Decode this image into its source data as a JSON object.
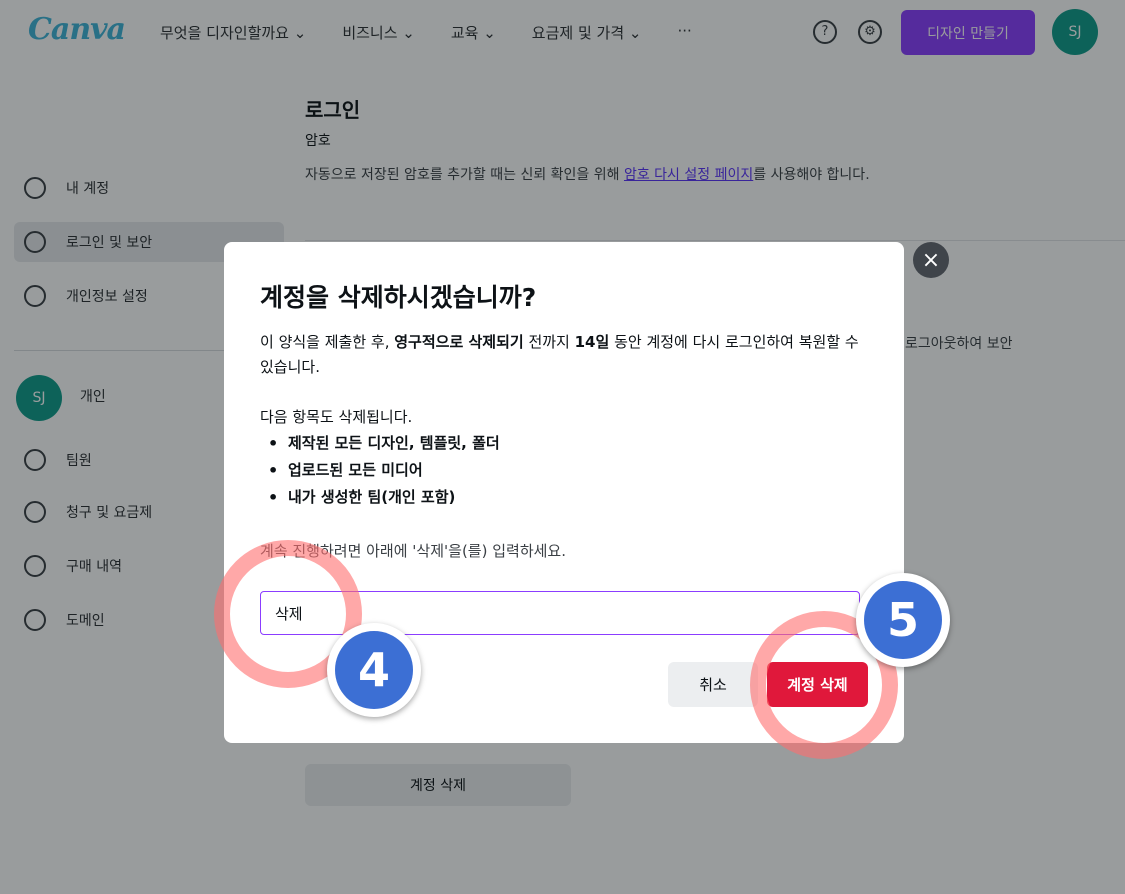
{
  "header": {
    "logo": "Canva",
    "nav": [
      "무엇을 디자인할까요 ⌄",
      "비즈니스 ⌄",
      "교육 ⌄",
      "요금제 및 가격 ⌄",
      "···"
    ],
    "cta_label": "디자인 만들기",
    "avatar_initials": "SJ"
  },
  "sidebar": {
    "items": [
      {
        "label": "내 계정"
      },
      {
        "label": "로그인 및 보안"
      },
      {
        "label": "개인정보 설정"
      }
    ],
    "account": {
      "initials": "SJ",
      "label": "개인"
    },
    "sub_items": [
      {
        "label": "팀원"
      },
      {
        "label": "청구 및 요금제"
      },
      {
        "label": "구매 내역"
      },
      {
        "label": "도메인"
      }
    ]
  },
  "main": {
    "title": "로그인",
    "subtitle": "암호",
    "desc_prefix": "자동으로 저장된 암호를 추가할 때는 신뢰 확인을 위해 ",
    "desc_link": "암호 다시 설정 페이지",
    "desc_suffix": "를 사용해야 합니다.",
    "right_text": "로그아웃하여 보안",
    "bottom_button": "계정 삭제"
  },
  "modal": {
    "close_symbol": "×",
    "title": "계정을 삭제하시겠습니까?",
    "p1_a": "이 양식을 제출한 후, ",
    "p1_b": "영구적으로 삭제되기",
    "p1_c": " 전까지 ",
    "p1_d": "14일",
    "p1_e": " 동안 계정에 다시 로그인하여 복원할 수 있습니다.",
    "p2": "다음 항목도 삭제됩니다.",
    "list": [
      "제작된 모든 디자인, 템플릿, 폴더",
      "업로드된 모든 미디어",
      "내가 생성한 팀(개인 포함)"
    ],
    "instruction": "계속 진행하려면 아래에 '삭제'을(를) 입력하세요.",
    "input_value": "삭제",
    "cancel_label": "취소",
    "delete_label": "계정 삭제"
  },
  "annotations": {
    "step4": "4",
    "step5": "5",
    "ring_color": "#ff6e6e",
    "badge_color": "#3c6fd4"
  }
}
